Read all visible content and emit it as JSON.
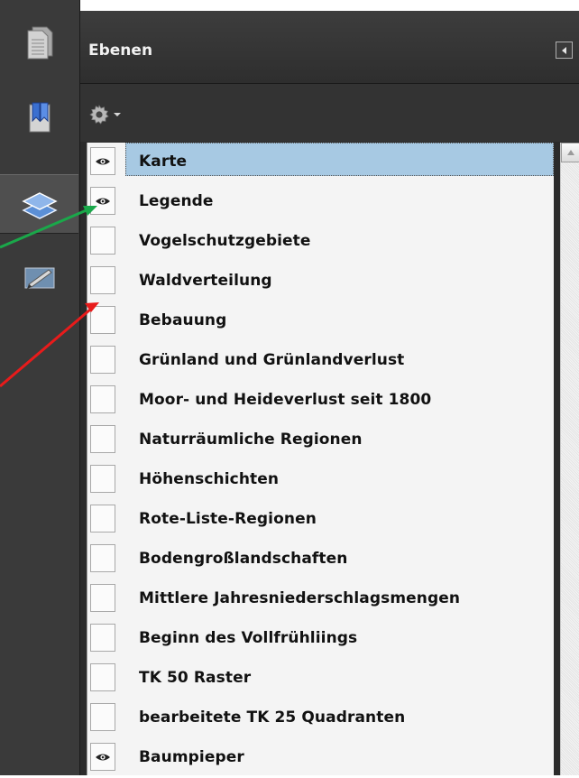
{
  "rail": {
    "items": [
      {
        "name": "pages-icon"
      },
      {
        "name": "bookmarks-icon"
      },
      {
        "name": "layers-icon",
        "active": true
      },
      {
        "name": "signatures-icon"
      }
    ]
  },
  "panel": {
    "title": "Ebenen",
    "options_icon": "gear-icon"
  },
  "layers": [
    {
      "label": "Karte",
      "visible": true,
      "selected": true
    },
    {
      "label": "Legende",
      "visible": true
    },
    {
      "label": "Vogelschutzgebiete",
      "visible": false
    },
    {
      "label": "Waldverteilung",
      "visible": false
    },
    {
      "label": "Bebauung",
      "visible": false
    },
    {
      "label": "Grünland und Grünlandverlust",
      "visible": false
    },
    {
      "label": "Moor- und Heideverlust seit 1800",
      "visible": false
    },
    {
      "label": "Naturräumliche Regionen",
      "visible": false
    },
    {
      "label": "Höhenschichten",
      "visible": false
    },
    {
      "label": "Rote-Liste-Regionen",
      "visible": false
    },
    {
      "label": "Bodengroßlandschaften",
      "visible": false
    },
    {
      "label": "Mittlere Jahresniederschlagsmengen",
      "visible": false
    },
    {
      "label": "Beginn des Vollfrühliings",
      "visible": false
    },
    {
      "label": "TK 50 Raster",
      "visible": false
    },
    {
      "label": "bearbeitete TK 25 Quadranten",
      "visible": false
    },
    {
      "label": "Baumpieper",
      "visible": true
    }
  ],
  "colors": {
    "selection": "#a7c9e3",
    "arrow_green": "#1aa84a",
    "arrow_red": "#e81b1b"
  }
}
